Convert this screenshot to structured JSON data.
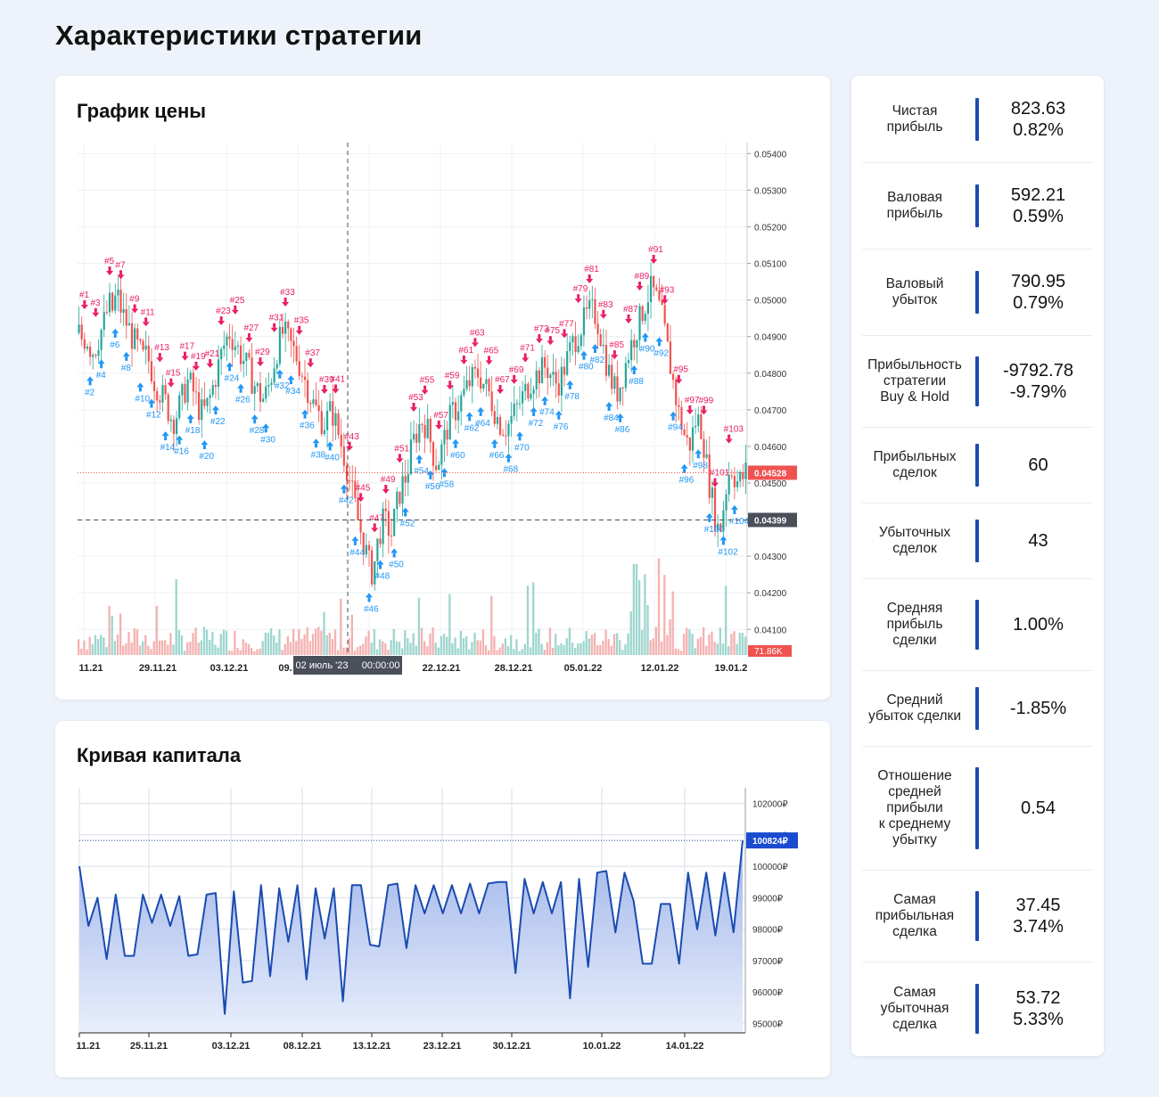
{
  "page": {
    "title": "Характеристики стратегии"
  },
  "price_chart": {
    "title": "График цены",
    "y_ticks": [
      "0.05400",
      "0.05300",
      "0.05200",
      "0.05100",
      "0.05000",
      "0.04900",
      "0.04800",
      "0.04700",
      "0.04600",
      "0.04500",
      "0.04400",
      "0.04300",
      "0.04200",
      "0.04100"
    ],
    "x_ticks": [
      "11.21",
      "29.11.21",
      "03.12.21",
      "09.",
      "22.12.21",
      "28.12.21",
      "05.01.22",
      "12.01.22",
      "19.01.2"
    ],
    "last_price_label": "0.04528",
    "crosshair_price_label": "0.04399",
    "crosshair_time_label": "02 июль '23     00:00:00",
    "volume_label": "71.86K",
    "colors": {
      "up": "#26a69a",
      "down": "#ef5350",
      "buy_marker": "#2196f3",
      "sell_marker": "#e91e63",
      "last_price": "#ef5350",
      "crosshair": "#4a4f5a"
    }
  },
  "chart_data": [
    {
      "type": "line",
      "title": "Кривая капитала",
      "xlabel": "",
      "ylabel": "",
      "x_ticks": [
        "11.21",
        "25.11.21",
        "03.12.21",
        "08.12.21",
        "13.12.21",
        "23.12.21",
        "30.12.21",
        "10.01.22",
        "14.01.22"
      ],
      "y_ticks": [
        "102000₽",
        "101000₽",
        "100000₽",
        "99000₽",
        "98000₽",
        "97000₽",
        "96000₽",
        "95000₽"
      ],
      "ylim": [
        94700,
        102500
      ],
      "last_value_label": "100824₽",
      "last_value": 100824,
      "grid": true,
      "series": [
        {
          "values": [
            100000,
            98100,
            99000,
            97050,
            99100,
            97150,
            97150,
            99100,
            98200,
            99100,
            98100,
            99050,
            97150,
            97200,
            99100,
            99150,
            95300,
            99200,
            96300,
            96350,
            99400,
            96500,
            99300,
            97600,
            99400,
            96400,
            99300,
            97700,
            99300,
            95700,
            99400,
            99400,
            97500,
            97450,
            99400,
            99450,
            97400,
            99400,
            98500,
            99400,
            98500,
            99400,
            98500,
            99450,
            98500,
            99450,
            99500,
            99500,
            96600,
            99600,
            98500,
            99500,
            98500,
            99500,
            95800,
            99600,
            96800,
            99800,
            99850,
            97900,
            99800,
            98900,
            96900,
            96900,
            98800,
            98800,
            96900,
            99800,
            98000,
            99800,
            97800,
            99800,
            97900,
            100824
          ]
        }
      ]
    },
    {
      "type": "candlestick",
      "title": "График цены",
      "ylim": [
        0.0403,
        0.0543
      ],
      "last_price": 0.04528,
      "crosshair_price": 0.04399,
      "close_path": [
        0.0491,
        0.0489,
        0.049,
        0.0487,
        0.0486,
        0.0489,
        0.0492,
        0.0495,
        0.0499,
        0.0497,
        0.0502,
        0.0498,
        0.0495,
        0.0493,
        0.049,
        0.0488,
        0.0486,
        0.0484,
        0.0485,
        0.0482,
        0.0478,
        0.0476,
        0.0474,
        0.0472,
        0.0469,
        0.0467,
        0.0469,
        0.0472,
        0.0475,
        0.0478,
        0.0476,
        0.0473,
        0.047,
        0.0469,
        0.0471,
        0.0474,
        0.0478,
        0.0482,
        0.0486,
        0.0489,
        0.0491,
        0.0489,
        0.0487,
        0.0485,
        0.0483,
        0.0481,
        0.0478,
        0.0476,
        0.0474,
        0.0473,
        0.0475,
        0.0479,
        0.0484,
        0.0488,
        0.0491,
        0.049,
        0.0488,
        0.0486,
        0.0484,
        0.0481,
        0.0478,
        0.0475,
        0.0472,
        0.047,
        0.0468,
        0.0466,
        0.0468,
        0.047,
        0.0467,
        0.0463,
        0.0459,
        0.0455,
        0.045,
        0.0445,
        0.044,
        0.0436,
        0.0432,
        0.0428,
        0.0425,
        0.0432,
        0.0437,
        0.044,
        0.0438,
        0.0436,
        0.0442,
        0.0447,
        0.045,
        0.0452,
        0.0458,
        0.0462,
        0.0465,
        0.0467,
        0.0466,
        0.0463,
        0.0458,
        0.0455,
        0.0458,
        0.0462,
        0.0466,
        0.0469,
        0.047,
        0.0472,
        0.0474,
        0.0476,
        0.0478,
        0.0479,
        0.048,
        0.0478,
        0.0476,
        0.0474,
        0.0471,
        0.0468,
        0.0466,
        0.0465,
        0.0466,
        0.0468,
        0.047,
        0.0472,
        0.0474,
        0.0476,
        0.0478,
        0.0479,
        0.048,
        0.0481,
        0.0482,
        0.048,
        0.0478,
        0.0477,
        0.0479,
        0.0482,
        0.0485,
        0.0488,
        0.049,
        0.0492,
        0.0494,
        0.0496,
        0.0497,
        0.0496,
        0.0493,
        0.0488,
        0.0483,
        0.0479,
        0.0476,
        0.0475,
        0.0478,
        0.0482,
        0.0486,
        0.0489,
        0.0492,
        0.0495,
        0.0498,
        0.0501,
        0.0503,
        0.0501,
        0.0498,
        0.0494,
        0.0488,
        0.0482,
        0.0476,
        0.047,
        0.0466,
        0.0462,
        0.046,
        0.0464,
        0.0468,
        0.0466,
        0.046,
        0.0452,
        0.0446,
        0.044,
        0.0436,
        0.0443,
        0.045,
        0.0455,
        0.0452,
        0.045,
        0.0451,
        0.0453
      ]
    }
  ],
  "equity_chart": {
    "title": "Кривая капитала",
    "line_color": "#1a4bb0",
    "fill_top": "#9fb5ea",
    "fill_bottom": "#e8eefb"
  },
  "stats": [
    {
      "label": "Чистая\nприбыль",
      "values": [
        "823.63",
        "0.82%"
      ]
    },
    {
      "label": "Валовая\nприбыль",
      "values": [
        "592.21",
        "0.59%"
      ]
    },
    {
      "label": "Валовый\nубыток",
      "values": [
        "790.95",
        "0.79%"
      ]
    },
    {
      "label": "Прибыльность\nстратегии\nBuy & Hold",
      "values": [
        "-9792.78",
        "-9.79%"
      ]
    },
    {
      "label": "Прибыльных\nсделок",
      "values": [
        "60"
      ]
    },
    {
      "label": "Убыточных\nсделок",
      "values": [
        "43"
      ]
    },
    {
      "label": "Средняя\nприбыль\nсделки",
      "values": [
        "1.00%"
      ]
    },
    {
      "label": "Средний\nубыток сделки",
      "values": [
        "-1.85%"
      ]
    },
    {
      "label": "Отношение\nсредней\nприбыли\nк среднему\nубытку",
      "values": [
        "0.54"
      ]
    },
    {
      "label": "Самая\nприбыльная\nсделка",
      "values": [
        "37.45",
        "3.74%"
      ]
    },
    {
      "label": "Самая\nубыточная\nсделка",
      "values": [
        "53.72",
        "5.33%"
      ]
    }
  ]
}
